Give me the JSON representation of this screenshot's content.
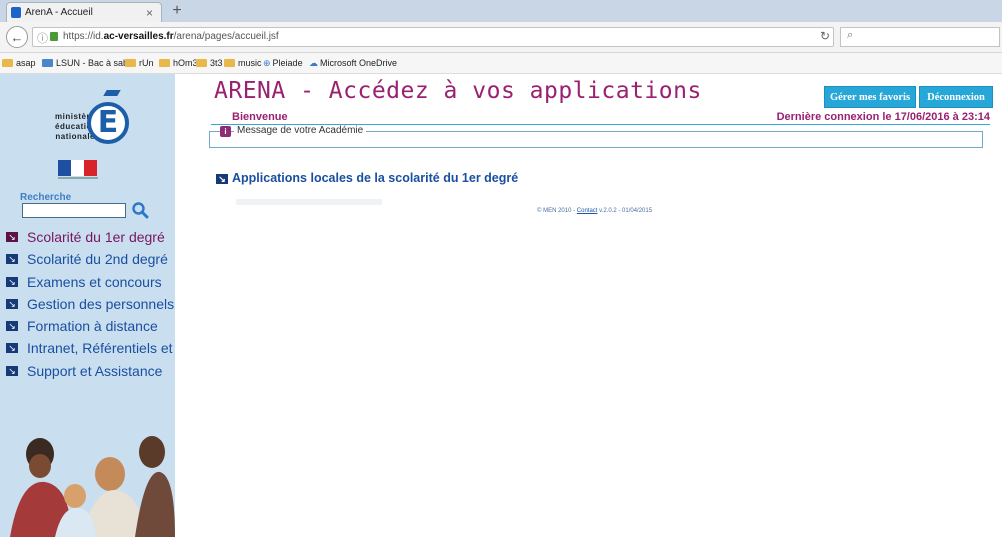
{
  "browser": {
    "tab_title": "ArenA - Accueil",
    "tab_close": "×",
    "new_tab": "+",
    "url_host_pre": "https://id.",
    "url_host_bold": "ac-versailles.fr",
    "url_path": "/arena/pages/accueil.jsf",
    "bookmarks": [
      "asap",
      "LSUN - Bac à sable",
      "rUn",
      "hOm3",
      "3t3",
      "music",
      "Pleiade",
      "Microsoft OneDrive"
    ]
  },
  "sidebar": {
    "logo_text": "ministère\néducation\nnationale",
    "logo_letter": "E",
    "search_label": "Recherche",
    "search_value": "",
    "menu": [
      {
        "label": "Scolarité du 1er degré",
        "active": true
      },
      {
        "label": "Scolarité du 2nd degré"
      },
      {
        "label": "Examens et concours"
      },
      {
        "label": "Gestion des personnels"
      },
      {
        "label": "Formation à distance"
      },
      {
        "label": "Intranet, Référentiels et Outils"
      },
      {
        "label": "Support et Assistance"
      }
    ]
  },
  "header": {
    "title": "ARENA - Accédez à vos applications",
    "fav_button": "Gérer mes favoris",
    "logout_button": "Déconnexion",
    "welcome": "Bienvenue",
    "last_login": "Dernière connexion le 17/06/2016 à  23:14"
  },
  "main": {
    "message_badge": "i",
    "message_label": "Message de votre Académie",
    "section_title": "Applications locales de la scolarité du 1er degré"
  },
  "footer": {
    "prefix": "© MEN 2010 - ",
    "contact": "Contact",
    "suffix": " v.2.0.2 - 01/04/2015"
  },
  "colors": {
    "sidebar_bg": "#c9dff0",
    "accent_purple": "#9a2070",
    "button_blue": "#26a7d8",
    "menu_blue": "#1a4fa0"
  }
}
